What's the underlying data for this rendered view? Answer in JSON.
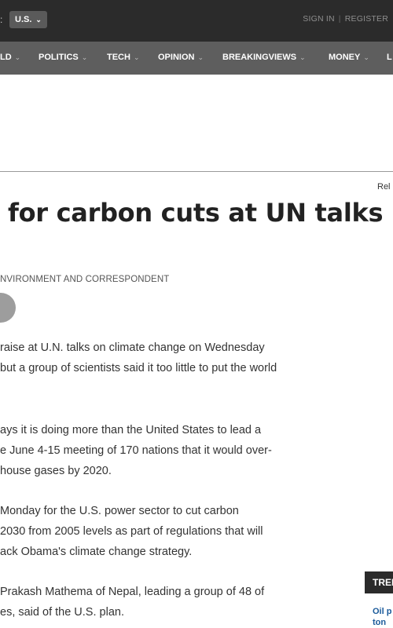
{
  "topbar": {
    "edition_prefix": ":",
    "edition_value": "U.S.",
    "sign_in": "SIGN IN",
    "register": "REGISTER"
  },
  "nav": {
    "items": [
      "LD",
      "POLITICS",
      "TECH",
      "OPINION",
      "BREAKINGVIEWS",
      "MONEY",
      "L"
    ]
  },
  "article": {
    "related_label": "Rel",
    "headline": "for carbon cuts at UN talks",
    "byline": "NVIRONMENT AND CORRESPONDENT",
    "paragraphs": [
      [
        "raise at U.N. talks on climate change on Wednesday",
        " but a group of scientists said it too little to put the world"
      ],
      [
        "ays it is doing more than the United States to lead a",
        "e June 4-15 meeting of 170 nations that it would over-",
        "house gases by 2020."
      ],
      [
        " Monday for the U.S. power sector to cut carbon",
        " 2030 from 2005 levels as part of regulations that will",
        "ack Obama's climate change strategy."
      ],
      [
        " Prakash Mathema of Nepal, leading a group of 48 of",
        "es, said of the U.S. plan."
      ]
    ]
  },
  "trending": {
    "heading": "TRENDING",
    "item": "Oil p ton"
  },
  "colors": {
    "topbar_bg": "#2b2b2b",
    "navbar_bg": "#5e5e5e",
    "link": "#1a5a9a"
  },
  "icons": {
    "edition_dropdown": "chevron-down-icon",
    "nav_dropdown": "chevron-down-icon",
    "share": "circle-button-icon"
  }
}
